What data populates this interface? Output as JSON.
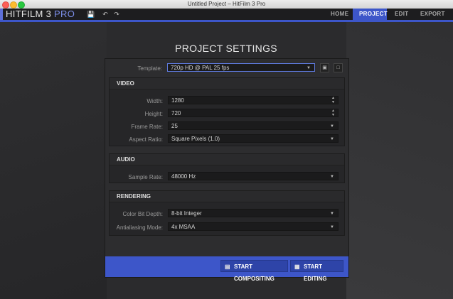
{
  "window": {
    "title": "Untitled Project – HitFilm 3 Pro"
  },
  "app": {
    "logo_main": "HITFILM 3",
    "logo_pro": "PRO",
    "toolbar_icons": [
      "save-icon",
      "undo-icon",
      "redo-icon"
    ],
    "tabs": [
      {
        "label": "HOME",
        "active": false
      },
      {
        "label": "PROJECT",
        "active": true
      },
      {
        "label": "EDIT",
        "active": false
      },
      {
        "label": "EXPORT",
        "active": false
      }
    ]
  },
  "dialog": {
    "title": "PROJECT SETTINGS",
    "template": {
      "label": "Template:",
      "value": "720p HD @ PAL 25 fps"
    },
    "video": {
      "header": "VIDEO",
      "width": {
        "label": "Width:",
        "value": "1280"
      },
      "height": {
        "label": "Height:",
        "value": "720"
      },
      "frame_rate": {
        "label": "Frame Rate:",
        "value": "25"
      },
      "aspect_ratio": {
        "label": "Aspect Ratio:",
        "value": "Square Pixels (1.0)"
      }
    },
    "audio": {
      "header": "AUDIO",
      "sample_rate": {
        "label": "Sample Rate:",
        "value": "48000 Hz"
      }
    },
    "rendering": {
      "header": "RENDERING",
      "color_bit_depth": {
        "label": "Color Bit Depth:",
        "value": "8-bit Integer"
      },
      "antialiasing": {
        "label": "Antialiasing Mode:",
        "value": "4x MSAA"
      }
    },
    "footer": {
      "start_compositing": "START COMPOSITING",
      "start_editing": "START EDITING"
    }
  },
  "colors": {
    "accent": "#3d56c9",
    "panel": "#2d2d2f",
    "field": "#1b1b1c"
  }
}
